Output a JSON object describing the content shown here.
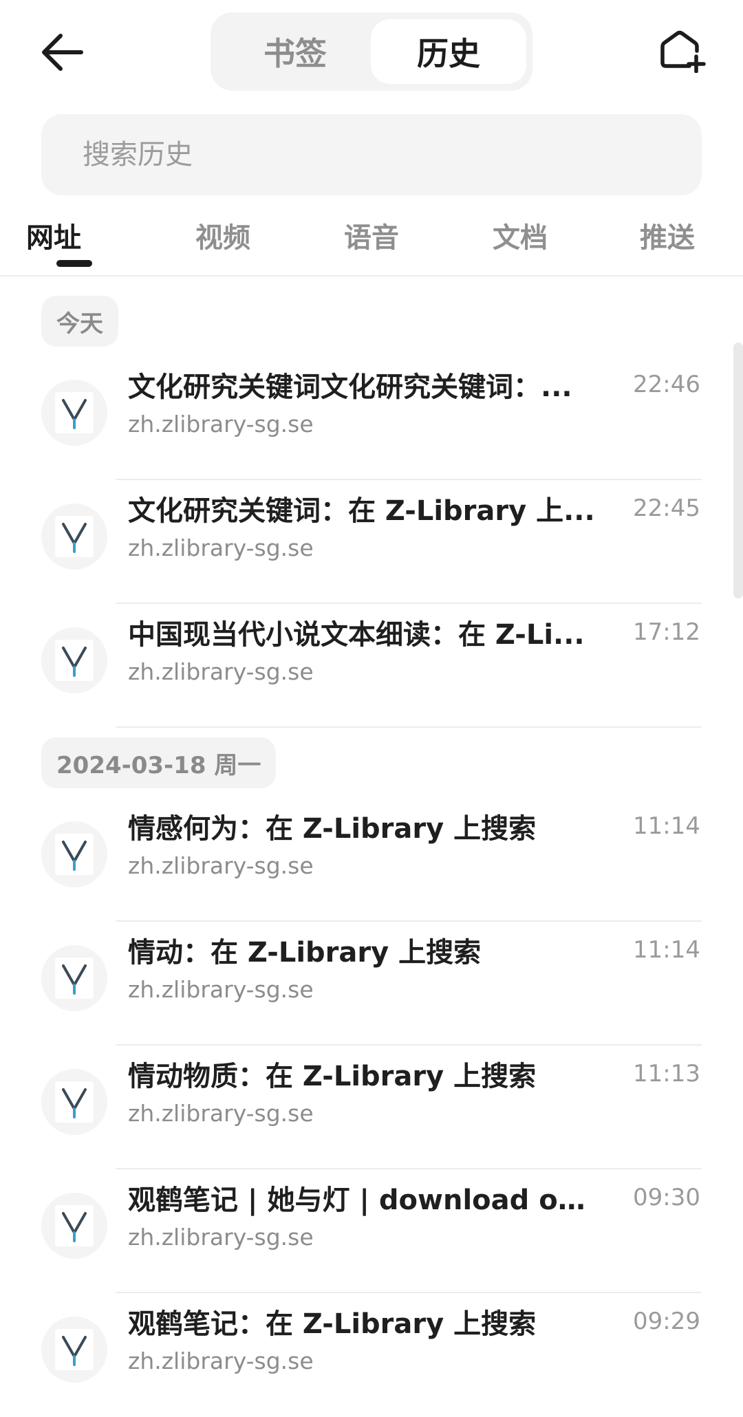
{
  "header": {
    "back_icon": "arrow-left-icon",
    "segments": [
      {
        "label": "书签",
        "active": false
      },
      {
        "label": "历史",
        "active": true
      }
    ],
    "add_home_icon": "home-plus-icon"
  },
  "search": {
    "placeholder": "搜索历史",
    "value": ""
  },
  "category_tabs": [
    {
      "label": "网址",
      "active": true
    },
    {
      "label": "视频",
      "active": false
    },
    {
      "label": "语音",
      "active": false
    },
    {
      "label": "文档",
      "active": false
    },
    {
      "label": "推送",
      "active": false
    }
  ],
  "groups": [
    {
      "date_label": "今天",
      "items": [
        {
          "title": "文化研究关键词文化研究关键词：...",
          "url": "zh.zlibrary-sg.se",
          "time": "22:46",
          "icon": "site-favicon"
        },
        {
          "title": "文化研究关键词：在 Z-Library 上...",
          "url": "zh.zlibrary-sg.se",
          "time": "22:45",
          "icon": "site-favicon"
        },
        {
          "title": "中国现当代小说文本细读：在 Z-Li...",
          "url": "zh.zlibrary-sg.se",
          "time": "17:12",
          "icon": "site-favicon"
        }
      ]
    },
    {
      "date_label": "2024-03-18 周一",
      "items": [
        {
          "title": "情感何为：在 Z-Library 上搜索",
          "url": "zh.zlibrary-sg.se",
          "time": "11:14",
          "icon": "site-favicon"
        },
        {
          "title": "情动：在 Z-Library 上搜索",
          "url": "zh.zlibrary-sg.se",
          "time": "11:14",
          "icon": "site-favicon"
        },
        {
          "title": "情动物质：在 Z-Library 上搜索",
          "url": "zh.zlibrary-sg.se",
          "time": "11:13",
          "icon": "site-favicon"
        },
        {
          "title": "观鹤笔记 | 她与灯 | download on Z...",
          "url": "zh.zlibrary-sg.se",
          "time": "09:30",
          "icon": "site-favicon"
        },
        {
          "title": "观鹤笔记：在 Z-Library 上搜索",
          "url": "zh.zlibrary-sg.se",
          "time": "09:29",
          "icon": "site-favicon"
        }
      ]
    }
  ],
  "colors": {
    "favicon_v": "#3b4a57",
    "favicon_accent": "#3aa0c8"
  }
}
